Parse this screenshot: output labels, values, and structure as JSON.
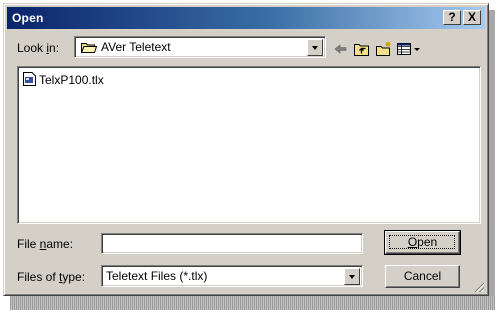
{
  "dialog": {
    "title": "Open",
    "help_label": "?",
    "close_label": "X"
  },
  "look_in": {
    "label_prefix": "Look ",
    "label_mnemonic": "i",
    "label_suffix": "n:",
    "value": "AVer Teletext",
    "icon": "folder-icon"
  },
  "toolbar": {
    "icons": [
      "back-arrow-icon",
      "up-folder-icon",
      "new-folder-icon",
      "view-menu-icon"
    ]
  },
  "file_list": {
    "items": [
      {
        "name": "TelxP100.tlx",
        "icon": "file-icon"
      }
    ]
  },
  "file_name": {
    "label_prefix": "File ",
    "label_mnemonic": "n",
    "label_suffix": "ame:",
    "value": ""
  },
  "file_type": {
    "label_prefix": "Files of ",
    "label_mnemonic": "t",
    "label_suffix": "ype:",
    "value": "Teletext Files (*.tlx)"
  },
  "buttons": {
    "open_mnemonic": "O",
    "open_rest": "pen",
    "cancel_label": "Cancel"
  },
  "colors": {
    "title_bar_start": "#0a246a",
    "title_bar_end": "#a6caf0",
    "face": "#d4d0c8"
  }
}
